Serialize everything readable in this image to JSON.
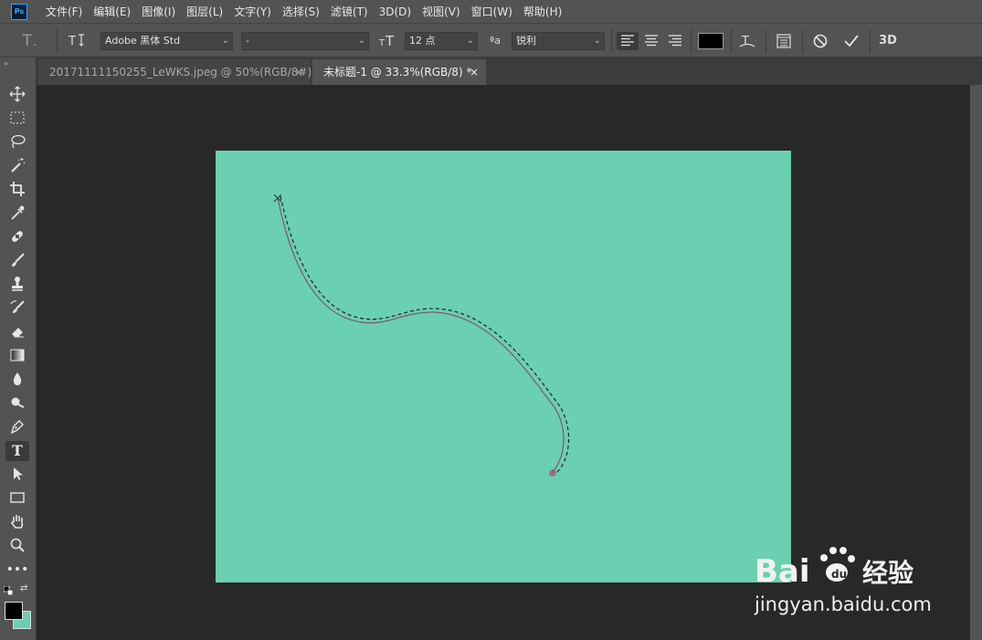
{
  "app": {
    "logo": "Ps"
  },
  "menu": [
    "文件(F)",
    "编辑(E)",
    "图像(I)",
    "图层(L)",
    "文字(Y)",
    "选择(S)",
    "滤镜(T)",
    "3D(D)",
    "视图(V)",
    "窗口(W)",
    "帮助(H)"
  ],
  "options": {
    "font_family": "Adobe 黑体 Std",
    "font_style": "-",
    "font_size": "12 点",
    "antialias_icon_text": "ªa",
    "antialias": "锐利",
    "color": "#000000",
    "three_d": "3D"
  },
  "tabs": [
    {
      "label": "20171111150255_LeWKS.jpeg @ 50%(RGB/8#) *",
      "close": "×",
      "active": false
    },
    {
      "label": "未标题-1 @ 33.3%(RGB/8) *",
      "close": "×",
      "active": true
    }
  ],
  "canvas": {
    "background": "#6bcfb1"
  },
  "swatches": {
    "foreground": "#000000",
    "background": "#6bcfb1"
  },
  "watermark": {
    "brand": "Bai",
    "brand_suffix": "经验",
    "url": "jingyan.baidu.com"
  }
}
